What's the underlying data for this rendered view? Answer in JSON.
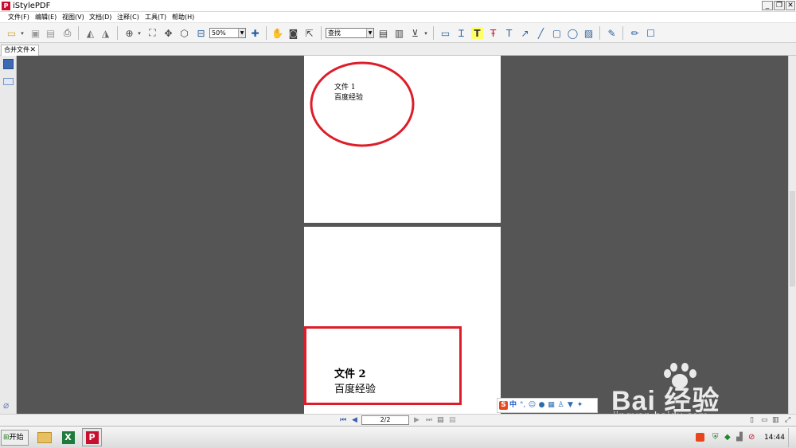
{
  "window": {
    "title": "iStylePDF",
    "app_icon_letter": "P",
    "min": "_",
    "restore": "❐",
    "close": "✕"
  },
  "menu": [
    "文件(F)",
    "编辑(E)",
    "视图(V)",
    "文档(D)",
    "注释(C)",
    "工具(T)",
    "帮助(H)"
  ],
  "toolbar": {
    "zoom_value": "50%",
    "find_value": "查找"
  },
  "tabs": [
    {
      "label": "合并文件",
      "close": "✕"
    }
  ],
  "document": {
    "page1": {
      "line1": "文件 1",
      "line2": "百度经验"
    },
    "page2": {
      "line1": "文件 2",
      "line2": "百度经验"
    }
  },
  "navigation": {
    "page_indicator": "2/2"
  },
  "ime": {
    "logo": "S",
    "mode": "中"
  },
  "taskbar": {
    "start_label": "开始",
    "clock": "14:44"
  },
  "watermark": {
    "brand": "Bai  经验",
    "url": "jingyan.baidu.com"
  },
  "colors": {
    "annotation_red": "#dd1e2a",
    "accent_red": "#c8102e",
    "workspace": "#555555"
  }
}
